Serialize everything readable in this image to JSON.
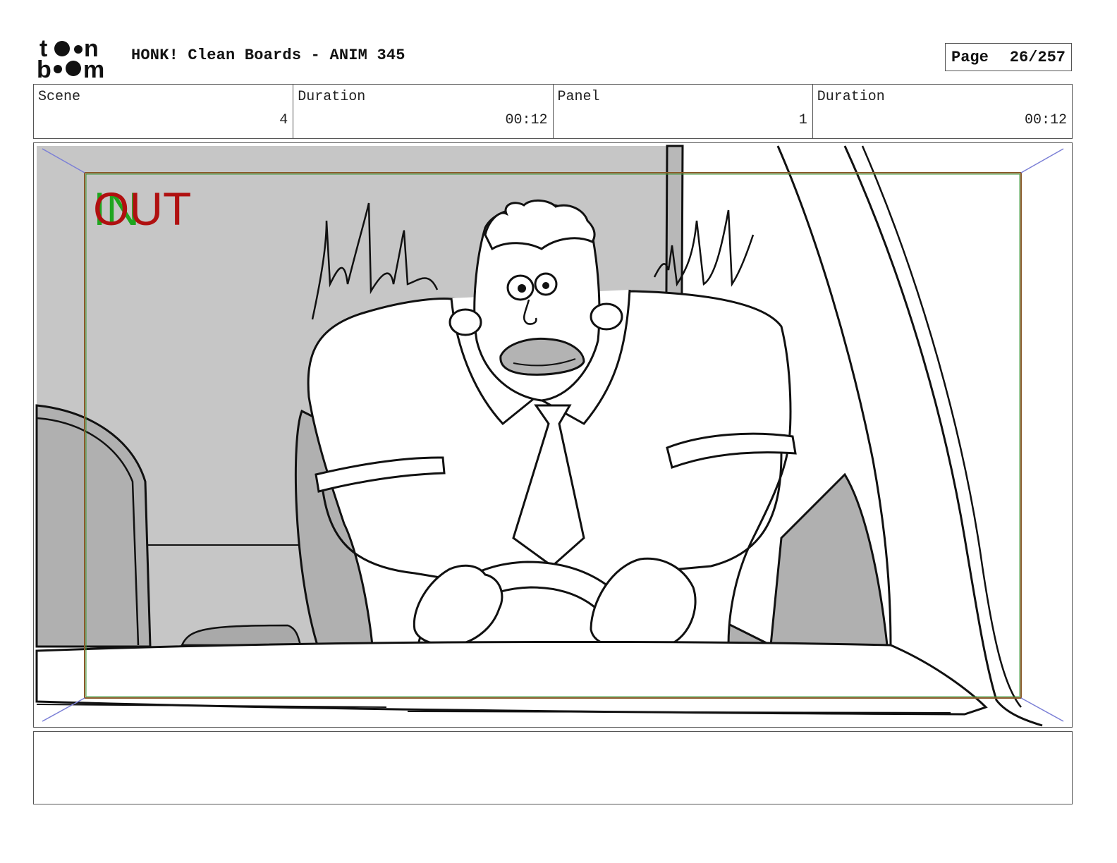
{
  "header": {
    "logo_icon": "toon-boom-logo",
    "title": "HONK! Clean Boards - ANIM 345",
    "page_label": "Page",
    "page_value": "26/257"
  },
  "info": {
    "scene_label": "Scene",
    "scene_value": "4",
    "scene_duration_label": "Duration",
    "scene_duration_value": "00:12",
    "panel_label": "Panel",
    "panel_value": "1",
    "panel_duration_label": "Duration",
    "panel_duration_value": "00:12"
  },
  "panel": {
    "in_label": "IN",
    "out_label": "OUT",
    "drawing_icon": "storyboard-sketch-driver-at-steering-wheel",
    "colors": {
      "wall": "#c6c6c6",
      "seat": "#b4b4b4",
      "in_marker": "#1fa51f",
      "out_marker": "#b01010",
      "frame_guide": "#8b5a2b",
      "corner_guides": "#7b7fd6"
    }
  },
  "notes": {
    "text": ""
  }
}
